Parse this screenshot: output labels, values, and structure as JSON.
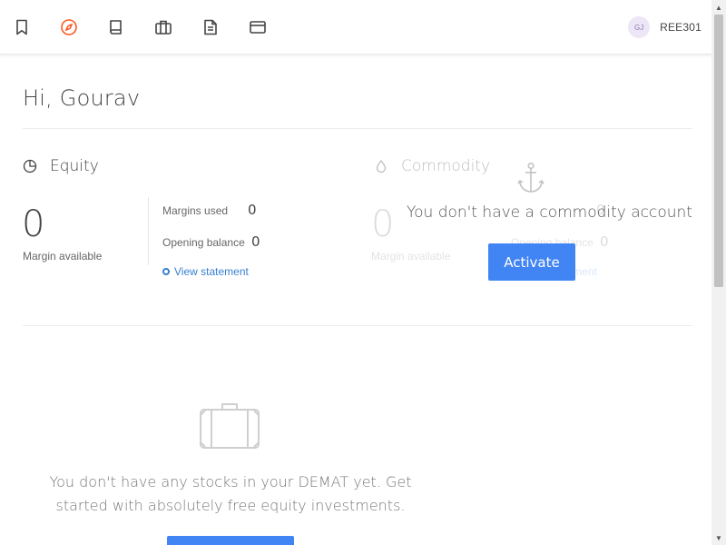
{
  "nav": {
    "icons": [
      "bookmark-icon",
      "compass-icon",
      "book-icon",
      "briefcase-icon",
      "document-icon",
      "card-icon"
    ],
    "active_color": "#ff5722"
  },
  "profile": {
    "initials": "GJ",
    "user_id": "REE301"
  },
  "greeting": "Hi, Gourav",
  "equity": {
    "title": "Equity",
    "margin_available_value": "0",
    "margin_available_label": "Margin available",
    "margins_used_label": "Margins used",
    "margins_used_value": "0",
    "opening_balance_label": "Opening balance",
    "opening_balance_value": "0",
    "view_statement_label": "View statement"
  },
  "commodity": {
    "title": "Commodity",
    "margin_available_value": "0",
    "margin_available_label": "Margin available",
    "margins_used_value": "0",
    "opening_balance_label": "Opening balance",
    "opening_balance_value": "0",
    "view_statement_label": "View statement",
    "no_account_message": "You don't have a commodity account",
    "activate_label": "Activate"
  },
  "holdings_empty": {
    "message": "You don't have any stocks in your DEMAT yet. Get started with absolutely free equity investments."
  },
  "colors": {
    "accent": "#4184f3",
    "link": "#387ed1",
    "text": "#444444"
  }
}
